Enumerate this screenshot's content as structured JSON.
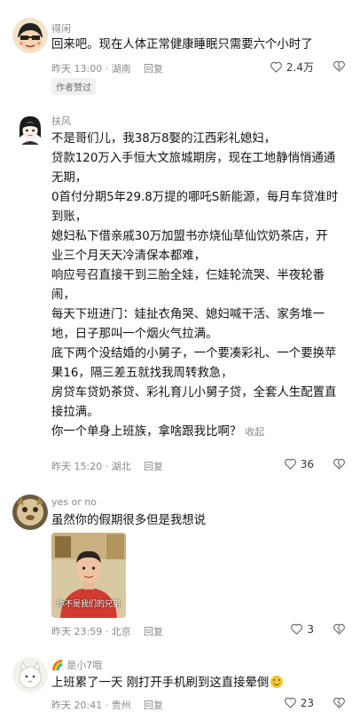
{
  "comments": [
    {
      "username": "得闲",
      "lines": [
        "回来吧。现在人体正常健康睡眠只需要六个小时了"
      ],
      "time_location": "昨天 13:00 · 湖南",
      "reply": "回复",
      "likes": "2.4万",
      "badge": "作者赞过"
    },
    {
      "username": "扶风",
      "lines": [
        "不是哥们儿，我38万8娶的江西彩礼媳妇，",
        "贷款120万入手恒大文旅城期房，现在工地静悄悄通通",
        "无期，",
        "0首付分期5年29.8万提的哪吒S新能源，每月车贷准时",
        "到账，",
        "媳妇私下借亲戚30万加盟书亦烧仙草仙饮奶茶店，开",
        "业三个月天天冷清保本都难，",
        "响应号召直接干到三胎全娃，仨娃轮流哭、半夜轮番",
        "闹，",
        "每天下班进门：娃扯衣角哭、媳妇喊干活、家务堆一",
        "地，日子那叫一个烟火气拉满。",
        "底下两个没结婚的小舅子，一个要凑彩礼、一个要换苹",
        "果16，隔三差五就找我周转救急，",
        "房贷车贷奶茶贷、彩礼育儿小舅子贷，全套人生配置直",
        "接拉满。",
        "你一个单身上班族，拿啥跟我比啊？"
      ],
      "collapse": "收起",
      "time_location": "昨天 15:20 · 湖北",
      "reply": "回复",
      "likes": "36"
    },
    {
      "username": "yes or no",
      "lines": [
        "虽然你的假期很多但是我想说"
      ],
      "sticker_caption": "你不是我们的兄弟",
      "time_location": "昨天 23:59 · 北京",
      "reply": "回复",
      "likes": "3"
    },
    {
      "username": "是小7哦",
      "username_prefix": "🌈",
      "lines": [
        "上班累了一天 刚打开手机刷到这直接晕倒"
      ],
      "time_location": "昨天 20:41 · 贵州",
      "reply": "回复",
      "likes": "23"
    }
  ]
}
